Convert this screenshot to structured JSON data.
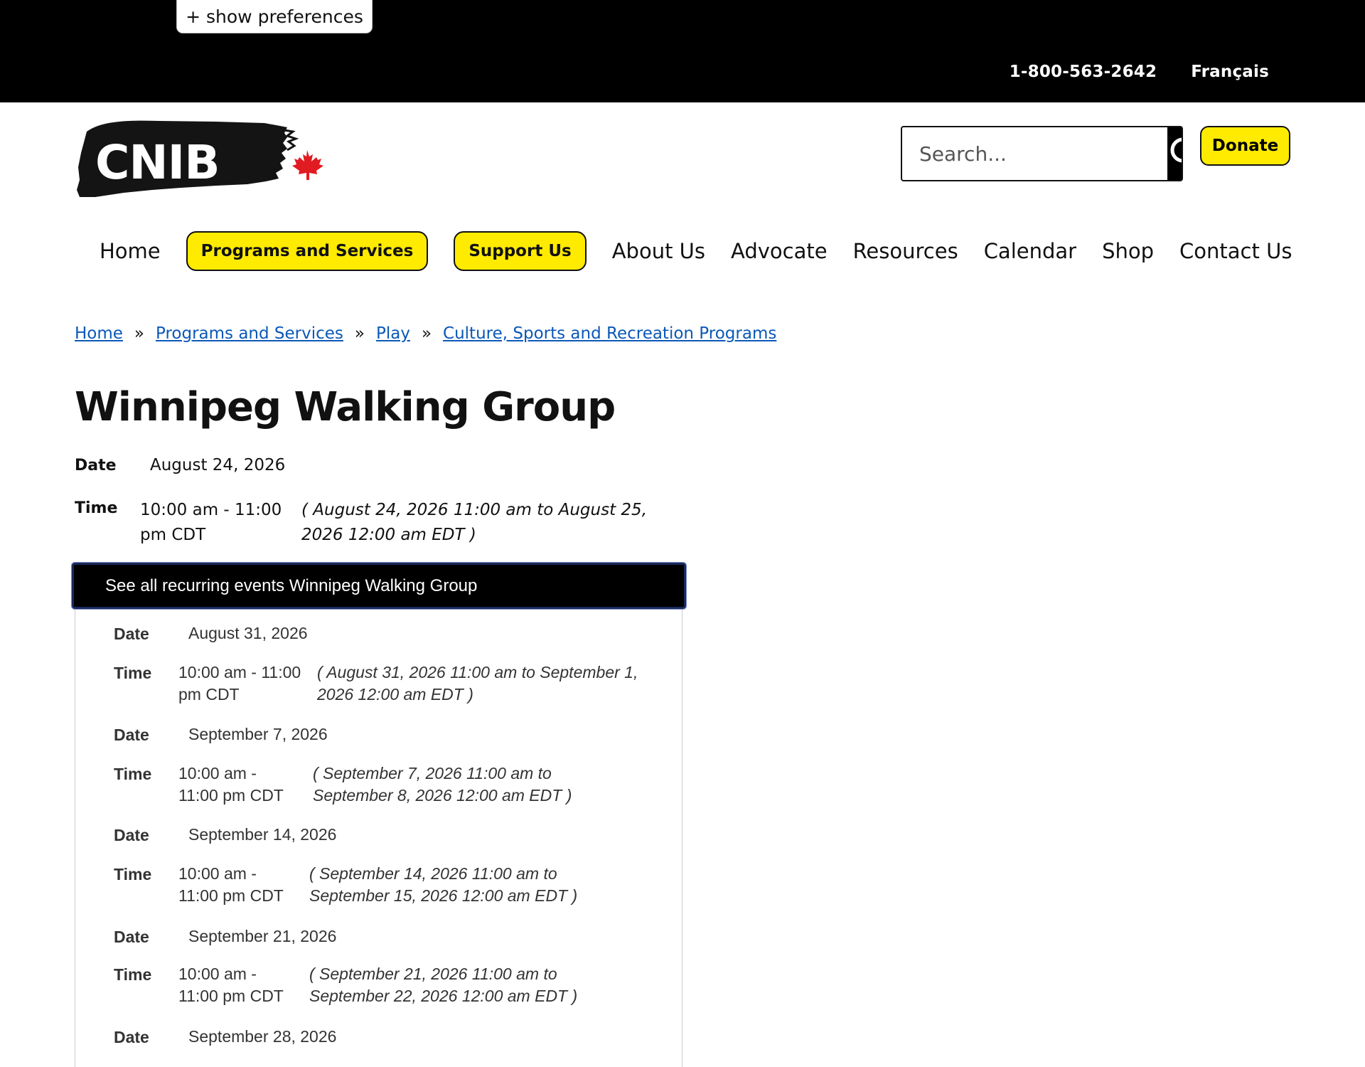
{
  "top_bar": {
    "preferences_button": "+ show preferences",
    "phone": "1-800-563-2642",
    "language": "Français"
  },
  "logo": {
    "text": "CNIB"
  },
  "search": {
    "placeholder": "Search..."
  },
  "donate_label": "Donate",
  "nav": {
    "items": [
      {
        "label": "Home",
        "style": "plain"
      },
      {
        "label": "Programs and Services",
        "style": "pill"
      },
      {
        "label": "Support Us",
        "style": "pill"
      },
      {
        "label": "About Us",
        "style": "plain"
      },
      {
        "label": "Advocate",
        "style": "plain"
      },
      {
        "label": "Resources",
        "style": "plain"
      },
      {
        "label": "Calendar",
        "style": "plain"
      },
      {
        "label": "Shop",
        "style": "plain"
      },
      {
        "label": "Contact Us",
        "style": "plain"
      }
    ]
  },
  "breadcrumb": {
    "items": [
      "Home",
      "Programs and Services",
      "Play",
      "Culture, Sports and Recreation Programs"
    ],
    "separator": "»"
  },
  "page_title": "Winnipeg Walking Group",
  "event": {
    "date_label": "Date",
    "date": "August 24, 2026",
    "time_label": "Time",
    "time": "10:00 am - 11:00 pm CDT",
    "time_alt": "( August 24, 2026 11:00 am to August 25, 2026 12:00 am EDT )"
  },
  "recurring": {
    "button_label": "See all recurring events Winnipeg Walking Group",
    "date_label": "Date",
    "time_label": "Time",
    "events": [
      {
        "date": "August 31, 2026",
        "time": "10:00 am - 11:00 pm CDT",
        "time_alt": "( August 31, 2026 11:00 am to September 1, 2026 12:00 am EDT )"
      },
      {
        "date": "September 7, 2026",
        "time": "10:00 am - 11:00 pm CDT",
        "time_alt": "( September 7, 2026 11:00 am to September 8, 2026 12:00 am EDT )"
      },
      {
        "date": "September 14, 2026",
        "time": "10:00 am - 11:00 pm CDT",
        "time_alt": "( September 14, 2026 11:00 am to September 15, 2026 12:00 am EDT )"
      },
      {
        "date": "September 21, 2026",
        "time": "10:00 am - 11:00 pm CDT",
        "time_alt": "( September 21, 2026 11:00 am to September 22, 2026 12:00 am EDT )"
      },
      {
        "date": "September 28, 2026"
      }
    ]
  },
  "colors": {
    "accent_yellow": "#ffeb00",
    "link_blue": "#0a58b8",
    "maple_red": "#e11b22"
  }
}
